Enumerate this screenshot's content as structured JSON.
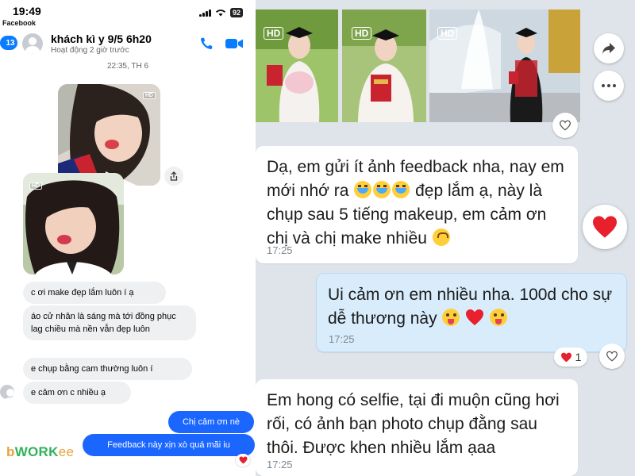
{
  "messenger": {
    "status_time": "19:49",
    "status_app": "Facebook",
    "battery": "92",
    "back_count": "13",
    "contact_name": "khách kì y 9/5 6h20",
    "contact_status": "Hoạt động 2 giờ trước",
    "timestamp": "22:35, TH 6",
    "hd_label": "HD",
    "messages_in": [
      "c ơi make đẹp lắm luôn í ạ",
      "áo cử nhân là sáng mà tới đồng phục lag chiều mà nền vẫn đẹp luôn",
      "e chụp bằng cam thường luôn í",
      "e cảm ơn c nhiều ạ"
    ],
    "messages_out": [
      "Chị cảm ơn nè",
      "Feedback này xịn xò quá mãi iu"
    ],
    "reaction": "heart"
  },
  "watermark": {
    "part1": "b",
    "part2": "WORK",
    "part3": "ee"
  },
  "zalo": {
    "hd_label": "HD",
    "msg1": {
      "text_a": "Dạ, em gửi ít ảnh feedback nha, nay em mới nhớ ra",
      "text_b": "đẹp lắm ạ, này là chụp sau 5 tiếng makeup, em cảm ơn chị và chị make nhiều",
      "time": "17:25"
    },
    "msg2": {
      "text": "Ui cảm ơn em nhiều nha. 100d cho sự dễ thương này",
      "time": "17:25",
      "reaction_count": "1"
    },
    "msg3": {
      "text": "Em hong có selfie, tại đi muộn cũng hơi rối, có ảnh bạn photo chụp đằng sau thôi. Được khen nhiều lắm ạaa",
      "time": "17:25"
    }
  },
  "colors": {
    "messenger_blue": "#1a66ff",
    "zalo_bg": "#dfe4ea",
    "zalo_out": "#d8ecfc",
    "heart_red": "#e8202e"
  }
}
